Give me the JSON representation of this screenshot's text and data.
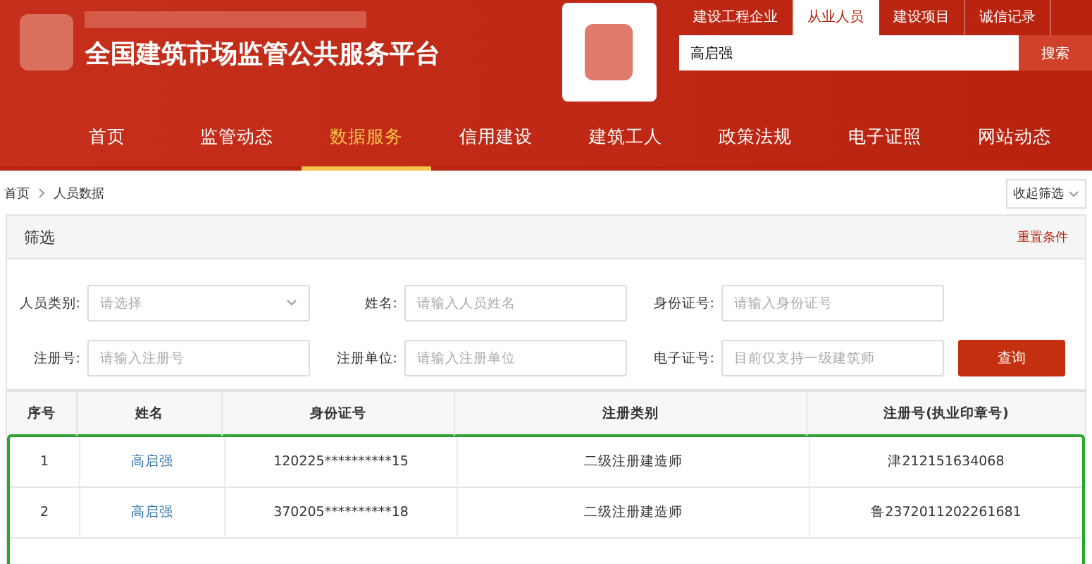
{
  "header": {
    "title": "全国建筑市场监管公共服务平台"
  },
  "search_tabs": [
    {
      "label": "建设工程企业",
      "selected": false
    },
    {
      "label": "从业人员",
      "selected": true
    },
    {
      "label": "建设项目",
      "selected": false
    },
    {
      "label": "诚信记录",
      "selected": false
    }
  ],
  "search": {
    "value": "高启强",
    "button": "搜索"
  },
  "nav": [
    {
      "label": "首页",
      "selected": false
    },
    {
      "label": "监管动态",
      "selected": false
    },
    {
      "label": "数据服务",
      "selected": true
    },
    {
      "label": "信用建设",
      "selected": false
    },
    {
      "label": "建筑工人",
      "selected": false
    },
    {
      "label": "政策法规",
      "selected": false
    },
    {
      "label": "电子证照",
      "selected": false
    },
    {
      "label": "网站动态",
      "selected": false
    }
  ],
  "breadcrumb": [
    "首页",
    "人员数据"
  ],
  "collapse_button": "收起筛选",
  "filter": {
    "title": "筛选",
    "reset": "重置条件",
    "query_button": "查询",
    "fields": [
      {
        "label": "人员类别:",
        "placeholder": "请选择",
        "kind": "select"
      },
      {
        "label": "姓名:",
        "placeholder": "请输入人员姓名",
        "kind": "input"
      },
      {
        "label": "身份证号:",
        "placeholder": "请输入身份证号",
        "kind": "input"
      },
      {
        "label": "注册号:",
        "placeholder": "请输入注册号",
        "kind": "input"
      },
      {
        "label": "注册单位:",
        "placeholder": "请输入注册单位",
        "kind": "input"
      },
      {
        "label": "电子证号:",
        "placeholder": "目前仅支持一级建筑师",
        "kind": "input"
      }
    ]
  },
  "table": {
    "columns": [
      "序号",
      "姓名",
      "身份证号",
      "注册类别",
      "注册号(执业印章号)"
    ],
    "rows": [
      [
        "1",
        "高启强",
        "120225**********15",
        "二级注册建造师",
        "津212151634068"
      ],
      [
        "2",
        "高启强",
        "370205**********18",
        "二级注册建造师",
        "鲁2372011202261681"
      ]
    ]
  }
}
